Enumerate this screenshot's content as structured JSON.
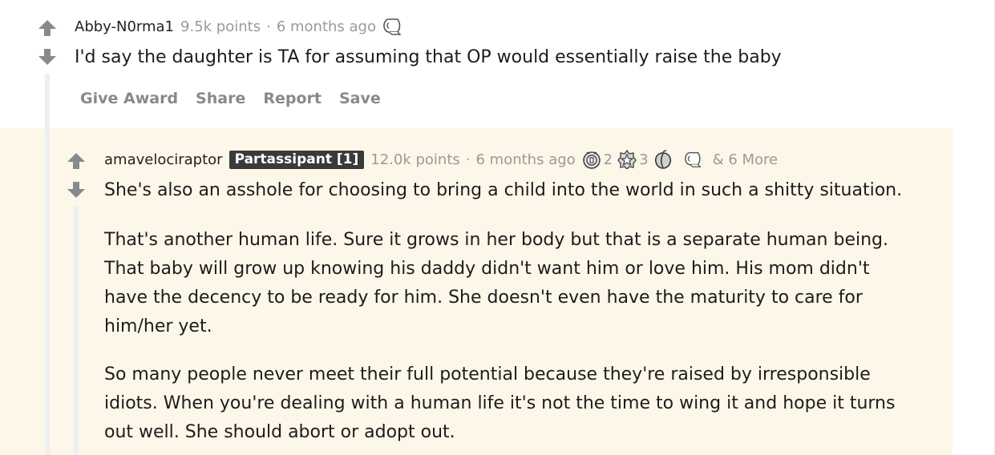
{
  "parent_comment": {
    "author": "Abby-N0rma1",
    "points": "9.5k points",
    "separator": "·",
    "time": "6 months ago",
    "award_icon": "toilet-paper-icon",
    "body": "I'd say the daughter is TA for assuming that OP would essentially raise the baby",
    "actions": {
      "give_award": "Give Award",
      "share": "Share",
      "report": "Report",
      "save": "Save"
    }
  },
  "reply_comment": {
    "author": "amavelociraptor",
    "flair": "Partassipant [1]",
    "points": "12.0k points",
    "separator": "·",
    "time": "6 months ago",
    "awards": [
      {
        "icon": "gold-coin-award-icon",
        "count": "2"
      },
      {
        "icon": "star-badge-award-icon",
        "count": "3"
      },
      {
        "icon": "peach-award-icon",
        "count": ""
      },
      {
        "icon": "toilet-paper-icon",
        "count": ""
      }
    ],
    "more_awards": "& 6 More",
    "paragraphs": [
      [
        "She's also an asshole for choosing to bring a child into the world in such a shitty situation."
      ],
      [
        "That's another human life. Sure it grows in her body but that is a separate human being.",
        "That baby will grow up knowing his daddy didn't want him or love him. His mom didn't",
        "have the decency to be ready for him. She doesn't even have the maturity to care for",
        "him/her yet."
      ],
      [
        "So many people never meet their full potential because they're raised by irresponsible",
        "idiots. When you're dealing with a human life it's not the time to wing it and hope it turns",
        "out well. She should abort or adopt out."
      ]
    ]
  },
  "colors": {
    "reply_background": "#fcf7e8",
    "flair_background": "#3a3a3a",
    "muted_text": "#9a9a9a",
    "action_text": "#878a8c",
    "thread_line": "#edeff1"
  }
}
